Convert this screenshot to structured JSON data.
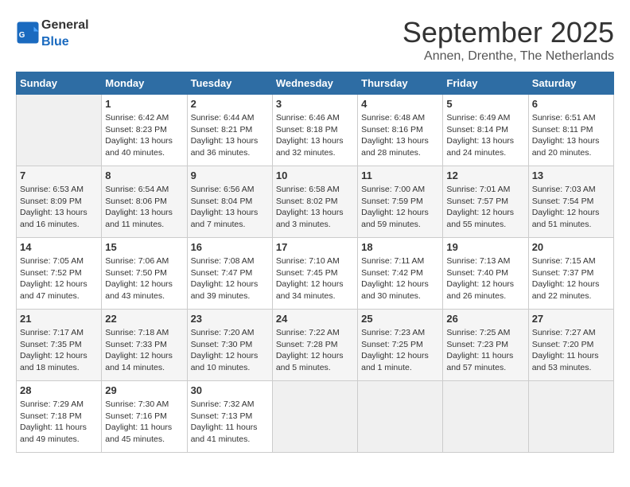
{
  "header": {
    "logo_general": "General",
    "logo_blue": "Blue",
    "month": "September 2025",
    "location": "Annen, Drenthe, The Netherlands"
  },
  "days_of_week": [
    "Sunday",
    "Monday",
    "Tuesday",
    "Wednesday",
    "Thursday",
    "Friday",
    "Saturday"
  ],
  "weeks": [
    [
      {
        "day": "",
        "info": ""
      },
      {
        "day": "1",
        "info": "Sunrise: 6:42 AM\nSunset: 8:23 PM\nDaylight: 13 hours\nand 40 minutes."
      },
      {
        "day": "2",
        "info": "Sunrise: 6:44 AM\nSunset: 8:21 PM\nDaylight: 13 hours\nand 36 minutes."
      },
      {
        "day": "3",
        "info": "Sunrise: 6:46 AM\nSunset: 8:18 PM\nDaylight: 13 hours\nand 32 minutes."
      },
      {
        "day": "4",
        "info": "Sunrise: 6:48 AM\nSunset: 8:16 PM\nDaylight: 13 hours\nand 28 minutes."
      },
      {
        "day": "5",
        "info": "Sunrise: 6:49 AM\nSunset: 8:14 PM\nDaylight: 13 hours\nand 24 minutes."
      },
      {
        "day": "6",
        "info": "Sunrise: 6:51 AM\nSunset: 8:11 PM\nDaylight: 13 hours\nand 20 minutes."
      }
    ],
    [
      {
        "day": "7",
        "info": "Sunrise: 6:53 AM\nSunset: 8:09 PM\nDaylight: 13 hours\nand 16 minutes."
      },
      {
        "day": "8",
        "info": "Sunrise: 6:54 AM\nSunset: 8:06 PM\nDaylight: 13 hours\nand 11 minutes."
      },
      {
        "day": "9",
        "info": "Sunrise: 6:56 AM\nSunset: 8:04 PM\nDaylight: 13 hours\nand 7 minutes."
      },
      {
        "day": "10",
        "info": "Sunrise: 6:58 AM\nSunset: 8:02 PM\nDaylight: 13 hours\nand 3 minutes."
      },
      {
        "day": "11",
        "info": "Sunrise: 7:00 AM\nSunset: 7:59 PM\nDaylight: 12 hours\nand 59 minutes."
      },
      {
        "day": "12",
        "info": "Sunrise: 7:01 AM\nSunset: 7:57 PM\nDaylight: 12 hours\nand 55 minutes."
      },
      {
        "day": "13",
        "info": "Sunrise: 7:03 AM\nSunset: 7:54 PM\nDaylight: 12 hours\nand 51 minutes."
      }
    ],
    [
      {
        "day": "14",
        "info": "Sunrise: 7:05 AM\nSunset: 7:52 PM\nDaylight: 12 hours\nand 47 minutes."
      },
      {
        "day": "15",
        "info": "Sunrise: 7:06 AM\nSunset: 7:50 PM\nDaylight: 12 hours\nand 43 minutes."
      },
      {
        "day": "16",
        "info": "Sunrise: 7:08 AM\nSunset: 7:47 PM\nDaylight: 12 hours\nand 39 minutes."
      },
      {
        "day": "17",
        "info": "Sunrise: 7:10 AM\nSunset: 7:45 PM\nDaylight: 12 hours\nand 34 minutes."
      },
      {
        "day": "18",
        "info": "Sunrise: 7:11 AM\nSunset: 7:42 PM\nDaylight: 12 hours\nand 30 minutes."
      },
      {
        "day": "19",
        "info": "Sunrise: 7:13 AM\nSunset: 7:40 PM\nDaylight: 12 hours\nand 26 minutes."
      },
      {
        "day": "20",
        "info": "Sunrise: 7:15 AM\nSunset: 7:37 PM\nDaylight: 12 hours\nand 22 minutes."
      }
    ],
    [
      {
        "day": "21",
        "info": "Sunrise: 7:17 AM\nSunset: 7:35 PM\nDaylight: 12 hours\nand 18 minutes."
      },
      {
        "day": "22",
        "info": "Sunrise: 7:18 AM\nSunset: 7:33 PM\nDaylight: 12 hours\nand 14 minutes."
      },
      {
        "day": "23",
        "info": "Sunrise: 7:20 AM\nSunset: 7:30 PM\nDaylight: 12 hours\nand 10 minutes."
      },
      {
        "day": "24",
        "info": "Sunrise: 7:22 AM\nSunset: 7:28 PM\nDaylight: 12 hours\nand 5 minutes."
      },
      {
        "day": "25",
        "info": "Sunrise: 7:23 AM\nSunset: 7:25 PM\nDaylight: 12 hours\nand 1 minute."
      },
      {
        "day": "26",
        "info": "Sunrise: 7:25 AM\nSunset: 7:23 PM\nDaylight: 11 hours\nand 57 minutes."
      },
      {
        "day": "27",
        "info": "Sunrise: 7:27 AM\nSunset: 7:20 PM\nDaylight: 11 hours\nand 53 minutes."
      }
    ],
    [
      {
        "day": "28",
        "info": "Sunrise: 7:29 AM\nSunset: 7:18 PM\nDaylight: 11 hours\nand 49 minutes."
      },
      {
        "day": "29",
        "info": "Sunrise: 7:30 AM\nSunset: 7:16 PM\nDaylight: 11 hours\nand 45 minutes."
      },
      {
        "day": "30",
        "info": "Sunrise: 7:32 AM\nSunset: 7:13 PM\nDaylight: 11 hours\nand 41 minutes."
      },
      {
        "day": "",
        "info": ""
      },
      {
        "day": "",
        "info": ""
      },
      {
        "day": "",
        "info": ""
      },
      {
        "day": "",
        "info": ""
      }
    ]
  ]
}
